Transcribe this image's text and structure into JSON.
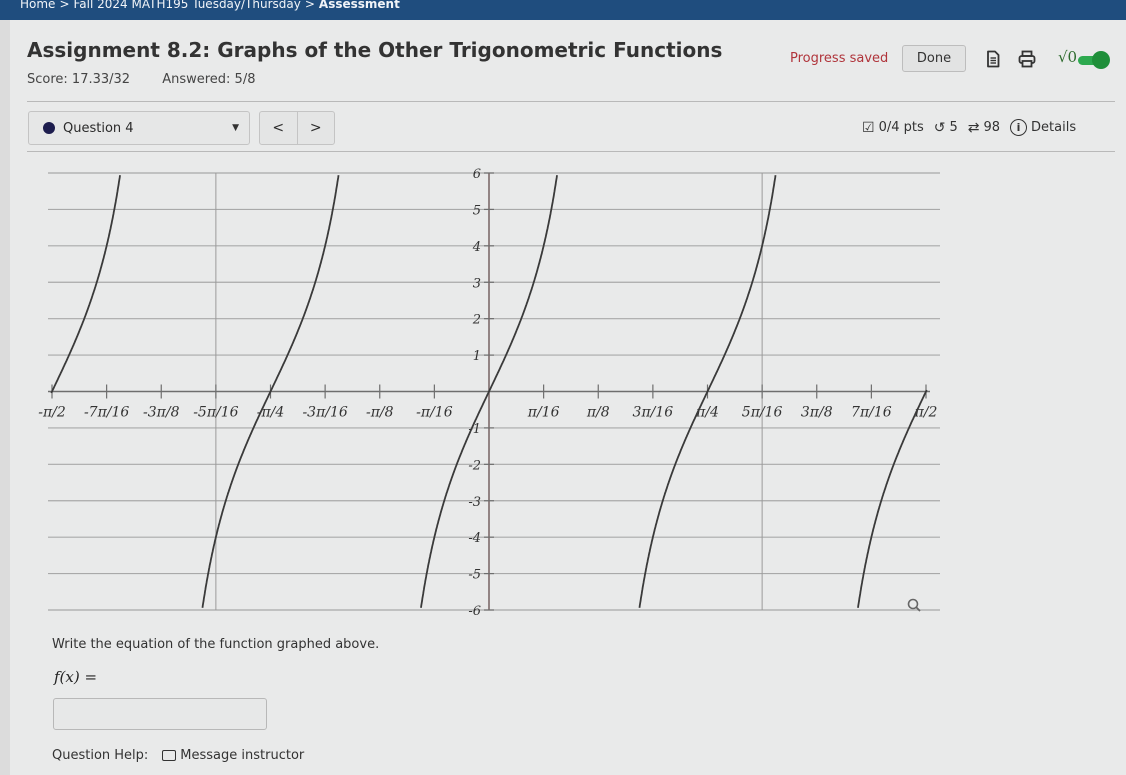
{
  "breadcrumb": {
    "items": [
      "Home",
      "Fall 2024 MATH195 Tuesday/Thursday",
      "Assessment"
    ],
    "separator": ">"
  },
  "assignment": {
    "title": "Assignment 8.2: Graphs of the Other Trigonometric Functions",
    "score": "Score: 17.33/32",
    "answered": "Answered: 5/8"
  },
  "header": {
    "progress_status": "Progress saved",
    "done_label": "Done",
    "icons": [
      "document-icon",
      "printer-icon",
      "math-toggle-icon"
    ],
    "math_label": "√0",
    "toggle_on": true,
    "toggle_color": "#1f8f3a",
    "status_color": "#b0343b"
  },
  "question_nav": {
    "selected": "Question 4",
    "prev_label": "<",
    "next_label": ">",
    "points": "0/4 pts",
    "retries": "5",
    "attempts": "98",
    "details_label": "Details"
  },
  "question": {
    "prompt": "Write the equation of the function graphed above.",
    "fx_label": "f(x) =",
    "answer_value": "",
    "help_label": "Question Help:",
    "message_label": "Message instructor"
  },
  "chart_data": {
    "type": "line",
    "title": "",
    "xlabel": "",
    "ylabel": "",
    "x_range_pi": [
      -0.5,
      0.5
    ],
    "y_range": [
      -6,
      6
    ],
    "x_tick_labels": [
      "-π/2",
      "-7π/16",
      "-3π/8",
      "-5π/16",
      "-π/4",
      "-3π/16",
      "-π/8",
      "-π/16",
      "π/16",
      "π/8",
      "3π/16",
      "π/4",
      "5π/16",
      "3π/8",
      "7π/16",
      "π/2"
    ],
    "x_ticks_pi": [
      -0.5,
      -0.4375,
      -0.375,
      -0.3125,
      -0.25,
      -0.1875,
      -0.125,
      -0.0625,
      0.0625,
      0.125,
      0.1875,
      0.25,
      0.3125,
      0.375,
      0.4375,
      0.5
    ],
    "y_tick_labels": [
      "-6",
      "-5",
      "-4",
      "-3",
      "-2",
      "-1",
      "1",
      "2",
      "3",
      "4",
      "5",
      "6"
    ],
    "y_ticks": [
      -6,
      -5,
      -4,
      -3,
      -2,
      -1,
      1,
      2,
      3,
      4,
      5,
      6
    ],
    "grid": true,
    "vertical_guides_pi": [
      -0.3125,
      0.3125
    ],
    "series": [
      {
        "name": "f(x)",
        "zeros_pi": [
          -0.5,
          -0.25,
          0,
          0.25,
          0.5
        ],
        "period_pi": 0.25,
        "amplitude_factor": 4,
        "shape": "tangent, increasing"
      }
    ]
  }
}
